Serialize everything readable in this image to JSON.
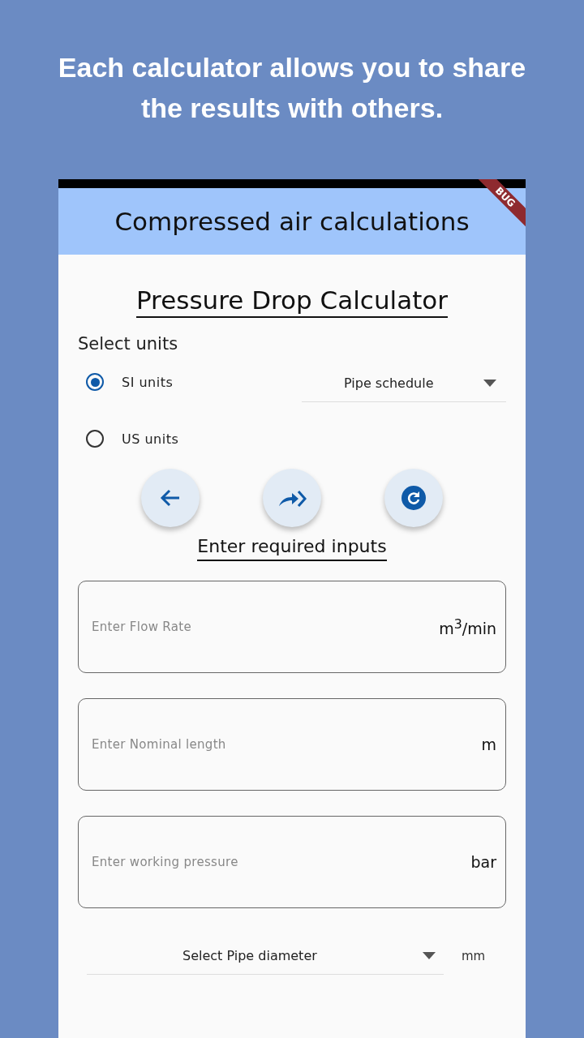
{
  "headline": "Each calculator allows you to share the results with others.",
  "debug_banner": "BUG",
  "app_bar": {
    "title": "Compressed air calculations"
  },
  "page_title": "Pressure Drop Calculator",
  "units": {
    "label": "Select units",
    "options": [
      {
        "label": "SI units",
        "selected": true
      },
      {
        "label": "US units",
        "selected": false
      }
    ]
  },
  "schedule_dropdown": {
    "value": "Pipe schedule"
  },
  "actions": [
    {
      "kind": "back"
    },
    {
      "kind": "share"
    },
    {
      "kind": "reset"
    }
  ],
  "inputs_title": "Enter required inputs",
  "fields": [
    {
      "placeholder": "Enter Flow Rate",
      "unit": "m$^{3}$/min"
    },
    {
      "placeholder": "Enter Nominal length",
      "unit": "m"
    },
    {
      "placeholder": "Enter working pressure",
      "unit": "bar"
    }
  ],
  "diameter_dropdown": {
    "value": "Select Pipe diameter",
    "unit": "mm"
  }
}
